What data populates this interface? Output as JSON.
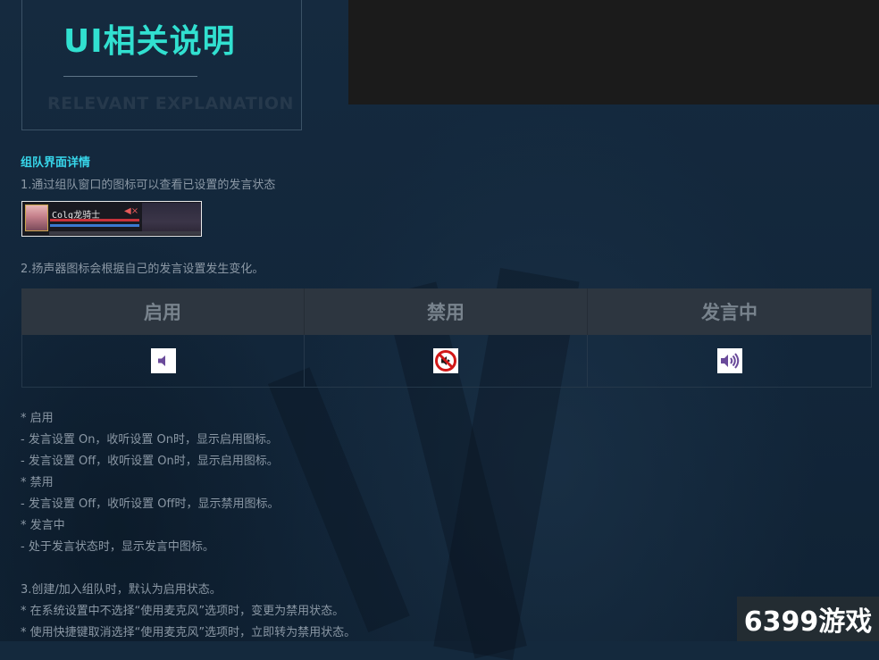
{
  "header": {
    "title_cn": "UI相关说明",
    "title_en": "RELEVANT EXPLANATION"
  },
  "section": {
    "heading": "组队界面详情",
    "line1": "1.通过组队窗口的图标可以查看已设置的发言状态",
    "party_widget": {
      "name": "Colg龙骑士"
    },
    "line2": "2.扬声器图标会根据自己的发言设置发生变化。"
  },
  "states_table": {
    "columns": [
      {
        "label": "启用",
        "icon": "speaker-icon"
      },
      {
        "label": "禁用",
        "icon": "speaker-muted-icon"
      },
      {
        "label": "发言中",
        "icon": "speaker-speaking-icon"
      }
    ]
  },
  "notes": [
    "* 启用",
    "- 发言设置 On，收听设置 On时，显示启用图标。",
    "- 发言设置 Off，收听设置 On时，显示启用图标。",
    "* 禁用",
    "- 发言设置 Off，收听设置 Off时，显示禁用图标。",
    "* 发言中",
    "- 处于发言状态时，显示发言中图标。",
    "",
    "3.创建/加入组队时，默认为启用状态。",
    "* 在系统设置中不选择“使用麦克风”选项时，变更为禁用状态。",
    "* 使用快捷键取消选择“使用麦克风”选项时，立即转为禁用状态。"
  ],
  "watermark": "6399游戏",
  "colors": {
    "accent_title": "#31e0d0",
    "accent_heading": "#37d6ea",
    "background": "#14293d",
    "icon_purple": "#6a4a9a",
    "mute_red": "#d11818"
  }
}
